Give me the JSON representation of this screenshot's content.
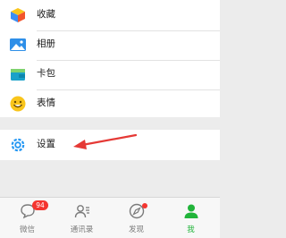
{
  "menu": {
    "items": [
      {
        "label": "收藏",
        "icon": "cube-icon"
      },
      {
        "label": "相册",
        "icon": "photo-album-icon"
      },
      {
        "label": "卡包",
        "icon": "card-wallet-icon"
      },
      {
        "label": "表情",
        "icon": "emoji-face-icon"
      }
    ],
    "settings": {
      "label": "设置",
      "icon": "gear-icon"
    }
  },
  "tabbar": {
    "tabs": [
      {
        "label": "微信",
        "icon": "chat-bubble-icon",
        "badge": "94"
      },
      {
        "label": "通讯录",
        "icon": "contacts-icon"
      },
      {
        "label": "发现",
        "icon": "compass-icon"
      },
      {
        "label": "我",
        "icon": "person-icon",
        "active": true
      }
    ]
  },
  "colors": {
    "accent_green": "#21b43a",
    "badge_red": "#f43530",
    "annotation_arrow": "#e53935",
    "gear_blue": "#2196f3"
  }
}
